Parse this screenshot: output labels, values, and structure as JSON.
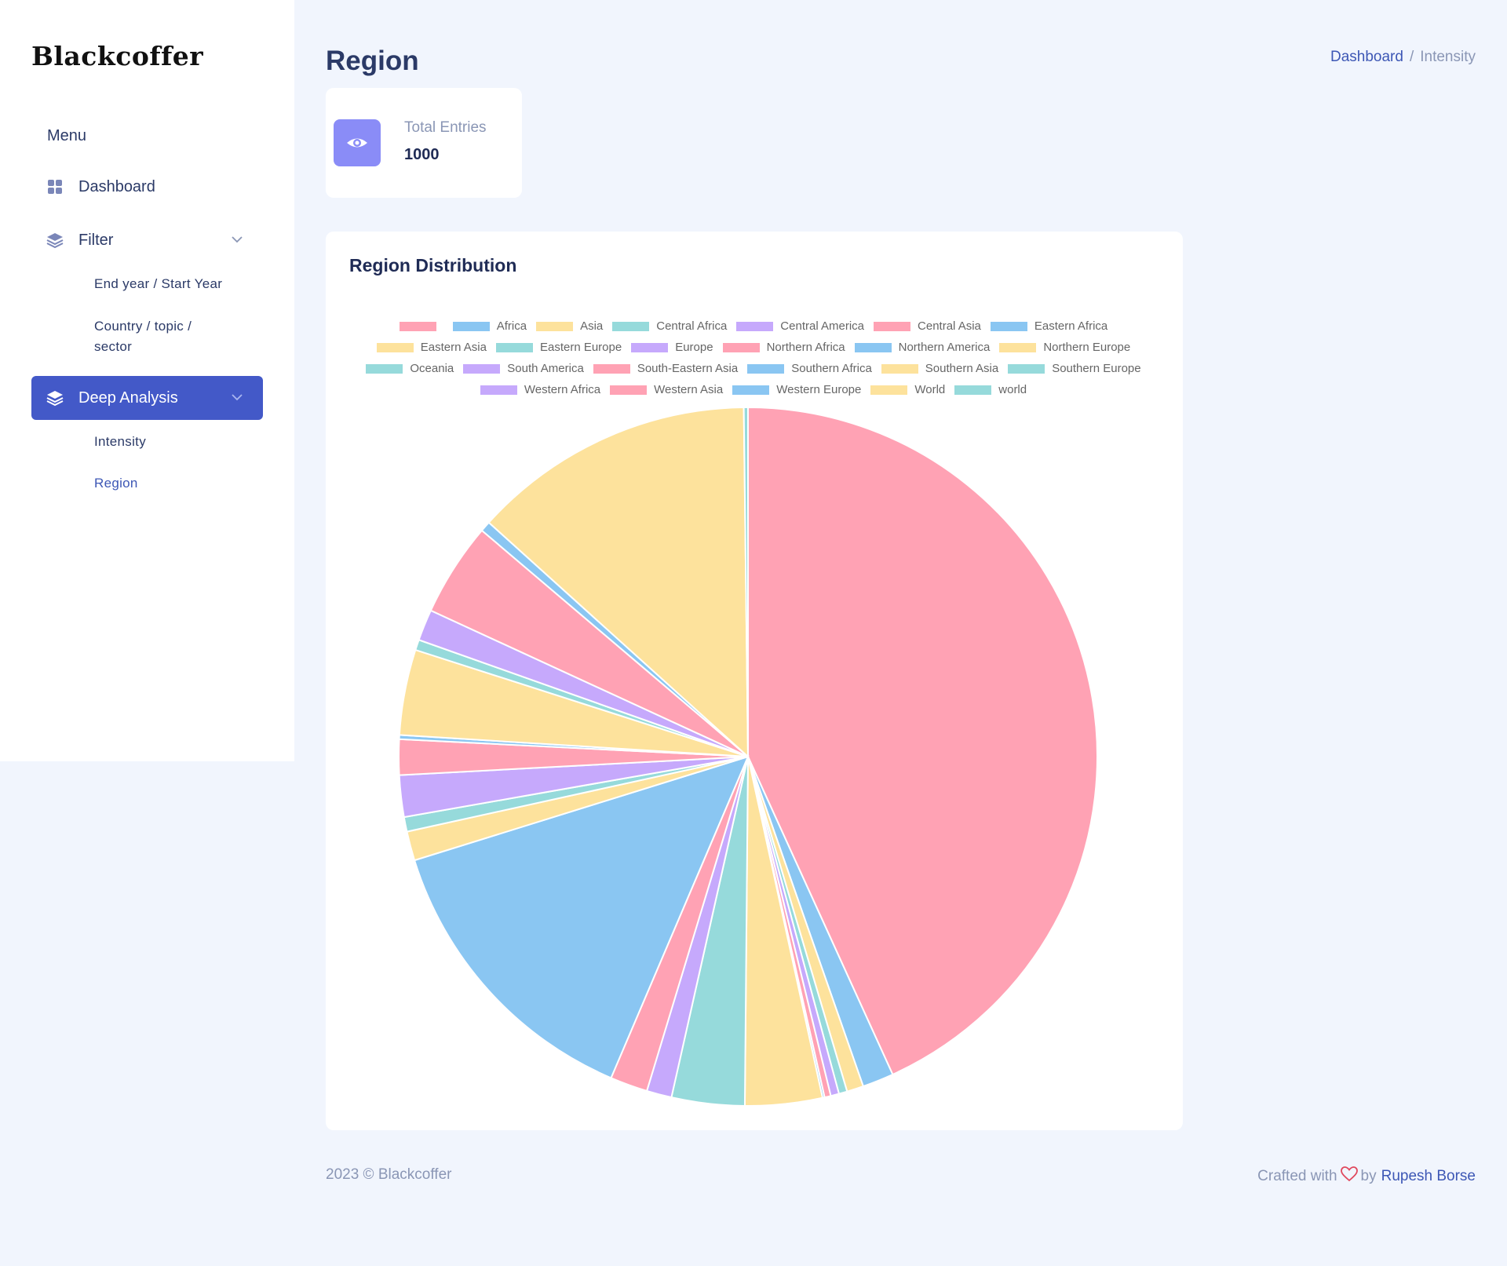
{
  "brand": {
    "name": "Blackcoffer"
  },
  "sidebar": {
    "menu_label": "Menu",
    "items": [
      {
        "label": "Dashboard",
        "icon": "grid-icon"
      },
      {
        "label": "Filter",
        "icon": "layers-icon"
      },
      {
        "label": "Deep Analysis",
        "icon": "layers-icon"
      }
    ],
    "filter_sub": [
      "End year / Start Year",
      "Country / topic /",
      "sector"
    ],
    "deep_sub": [
      "Intensity",
      "Region"
    ]
  },
  "header": {
    "title": "Region",
    "breadcrumb": [
      "Dashboard",
      "Intensity"
    ],
    "breadcrumb_sep": "/"
  },
  "stat": {
    "label": "Total Entries",
    "value": "1000",
    "icon": "eye-icon"
  },
  "chart": {
    "title": "Region Distribution"
  },
  "chart_data": {
    "type": "pie",
    "title": "Region Distribution",
    "legend_placement": "top",
    "palette": [
      "#ffa2b4",
      "#8ac6f2",
      "#fde29c",
      "#96dadb",
      "#c6a9fc"
    ],
    "categories": [
      "",
      "Africa",
      "Asia",
      "Central Africa",
      "Central America",
      "Central Asia",
      "Eastern Africa",
      "Eastern Asia",
      "Eastern Europe",
      "Europe",
      "Northern Africa",
      "Northern America",
      "Northern Europe",
      "Oceania",
      "South America",
      "South-Eastern Asia",
      "Southern Africa",
      "Southern Asia",
      "Southern Europe",
      "Western Africa",
      "Western Asia",
      "Western Europe",
      "World",
      "world"
    ],
    "values": [
      448,
      15,
      8,
      4,
      4,
      3,
      1,
      37,
      35,
      12,
      18,
      143,
      14,
      7,
      20,
      17,
      2,
      41,
      5,
      15,
      45,
      5,
      136,
      2
    ]
  },
  "footer": {
    "copyright": "2023 © Blackcoffer",
    "crafted": "Crafted with",
    "by": "by",
    "author": "Rupesh Borse"
  }
}
